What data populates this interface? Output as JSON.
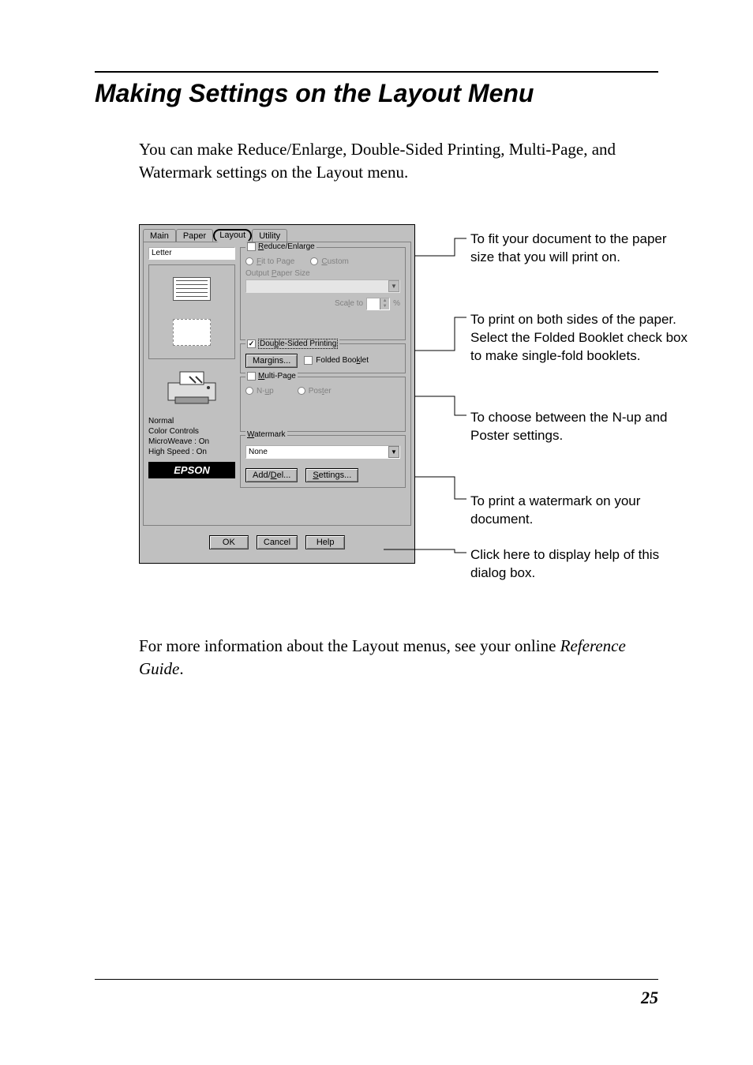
{
  "heading": "Making Settings on the Layout Menu",
  "intro": "You can make Reduce/Enlarge, Double-Sided Printing, Multi-Page, and Watermark settings on the Layout menu.",
  "outro_part1": "For more information about the Layout menus, see your online ",
  "outro_ref": "Reference Guide",
  "outro_part2": ".",
  "page_number": "25",
  "tabs": {
    "main": "Main",
    "paper": "Paper",
    "layout": "Layout",
    "utility": "Utility"
  },
  "dialog": {
    "paper_size_value": "Letter",
    "status": {
      "line1": "Normal",
      "line2": "Color Controls",
      "line3": "MicroWeave : On",
      "line4": "High Speed : On"
    },
    "logo": "EPSON",
    "reduce": {
      "legend": "Reduce/Enlarge",
      "fit": "Fit to Page",
      "custom": "Custom",
      "output_label": "Output Paper Size",
      "scale_label": "Scale to",
      "scale_unit": "%"
    },
    "dsp": {
      "legend": "Double-Sided Printing",
      "margins": "Margins...",
      "folded": "Folded Booklet"
    },
    "multipage": {
      "legend": "Multi-Page",
      "nup": "N-up",
      "poster": "Poster"
    },
    "watermark": {
      "legend": "Watermark",
      "value": "None",
      "adddel": "Add/Del...",
      "settings": "Settings..."
    },
    "buttons": {
      "ok": "OK",
      "cancel": "Cancel",
      "help": "Help"
    }
  },
  "callouts": {
    "c1": "To fit your document to the paper size that you will print on.",
    "c2": "To print on both sides of the paper. Select the Folded Booklet check box to make single-fold booklets.",
    "c3": "To choose between the N-up and Poster settings.",
    "c4": "To print a watermark on your document.",
    "c5": "Click here to display help of this dialog box."
  }
}
